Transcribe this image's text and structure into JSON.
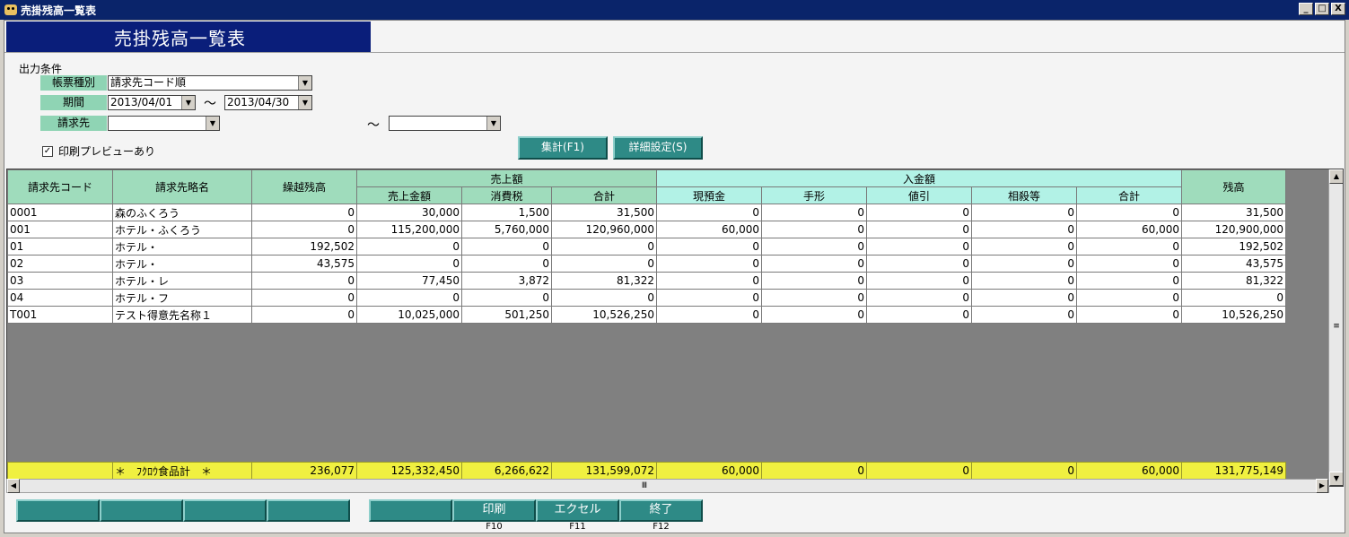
{
  "window": {
    "title": "売掛残高一覧表",
    "buttons": [
      "_",
      "□",
      "X"
    ]
  },
  "banner": {
    "title": "売掛残高一覧表"
  },
  "conditions": {
    "heading": "出力条件",
    "report_type": {
      "label": "帳票種別",
      "value": "請求先コード順"
    },
    "period": {
      "label": "期間",
      "from": "2013/04/01",
      "to": "2013/04/30",
      "sep": "〜"
    },
    "billing": {
      "label": "請求先",
      "from": "",
      "to": "",
      "sep": "〜"
    },
    "preview": {
      "label": "印刷プレビューあり",
      "checked": true,
      "mark": "✓"
    }
  },
  "actions": {
    "aggregate": "集計(F1)",
    "detail": "詳細設定(S)"
  },
  "grid": {
    "headers": {
      "code": "請求先コード",
      "name": "請求先略名",
      "carry": "繰越残高",
      "sales_group": "売上額",
      "sales_amount": "売上金額",
      "tax": "消費税",
      "sales_total": "合計",
      "receipts_group": "入金額",
      "cash": "現預金",
      "bill": "手形",
      "discount": "値引",
      "offset": "相殺等",
      "receipts_total": "合計",
      "balance": "残高"
    },
    "rows": [
      [
        "0001",
        "森のふくろう",
        "0",
        "30,000",
        "1,500",
        "31,500",
        "0",
        "0",
        "0",
        "0",
        "0",
        "31,500"
      ],
      [
        "001",
        "ホテル・ふくろう",
        "0",
        "115,200,000",
        "5,760,000",
        "120,960,000",
        "60,000",
        "0",
        "0",
        "0",
        "60,000",
        "120,900,000"
      ],
      [
        "01",
        "ホテル・",
        "192,502",
        "0",
        "0",
        "0",
        "0",
        "0",
        "0",
        "0",
        "0",
        "192,502"
      ],
      [
        "02",
        "ホテル・",
        "43,575",
        "0",
        "0",
        "0",
        "0",
        "0",
        "0",
        "0",
        "0",
        "43,575"
      ],
      [
        "03",
        "ホテル・レ",
        "0",
        "77,450",
        "3,872",
        "81,322",
        "0",
        "0",
        "0",
        "0",
        "0",
        "81,322"
      ],
      [
        "04",
        "ホテル・フ",
        "0",
        "0",
        "0",
        "0",
        "0",
        "0",
        "0",
        "0",
        "0",
        "0"
      ],
      [
        "T001",
        "テスト得意先名称１",
        "0",
        "10,025,000",
        "501,250",
        "10,526,250",
        "0",
        "0",
        "0",
        "0",
        "0",
        "10,526,250"
      ]
    ],
    "total": {
      "label": "＊　ﾌｸﾛｳ食品計　＊",
      "values": [
        "236,077",
        "125,332,450",
        "6,266,622",
        "131,599,072",
        "60,000",
        "0",
        "0",
        "0",
        "60,000",
        "131,775,149"
      ]
    }
  },
  "function_keys": [
    {
      "label": "",
      "key": ""
    },
    {
      "label": "",
      "key": ""
    },
    {
      "label": "",
      "key": ""
    },
    {
      "label": "",
      "key": ""
    },
    {
      "label": "",
      "key": ""
    },
    {
      "label": "印刷",
      "key": "F10"
    },
    {
      "label": "エクセル",
      "key": "F11"
    },
    {
      "label": "終了",
      "key": "F12"
    }
  ],
  "colors": {
    "title_bar": "#0a246a",
    "banner": "#0a1e7a",
    "header_green": "#9fdcbc",
    "header_cyan": "#b2f2e6",
    "total_row": "#f0f040",
    "button_teal": "#2e8a86"
  }
}
